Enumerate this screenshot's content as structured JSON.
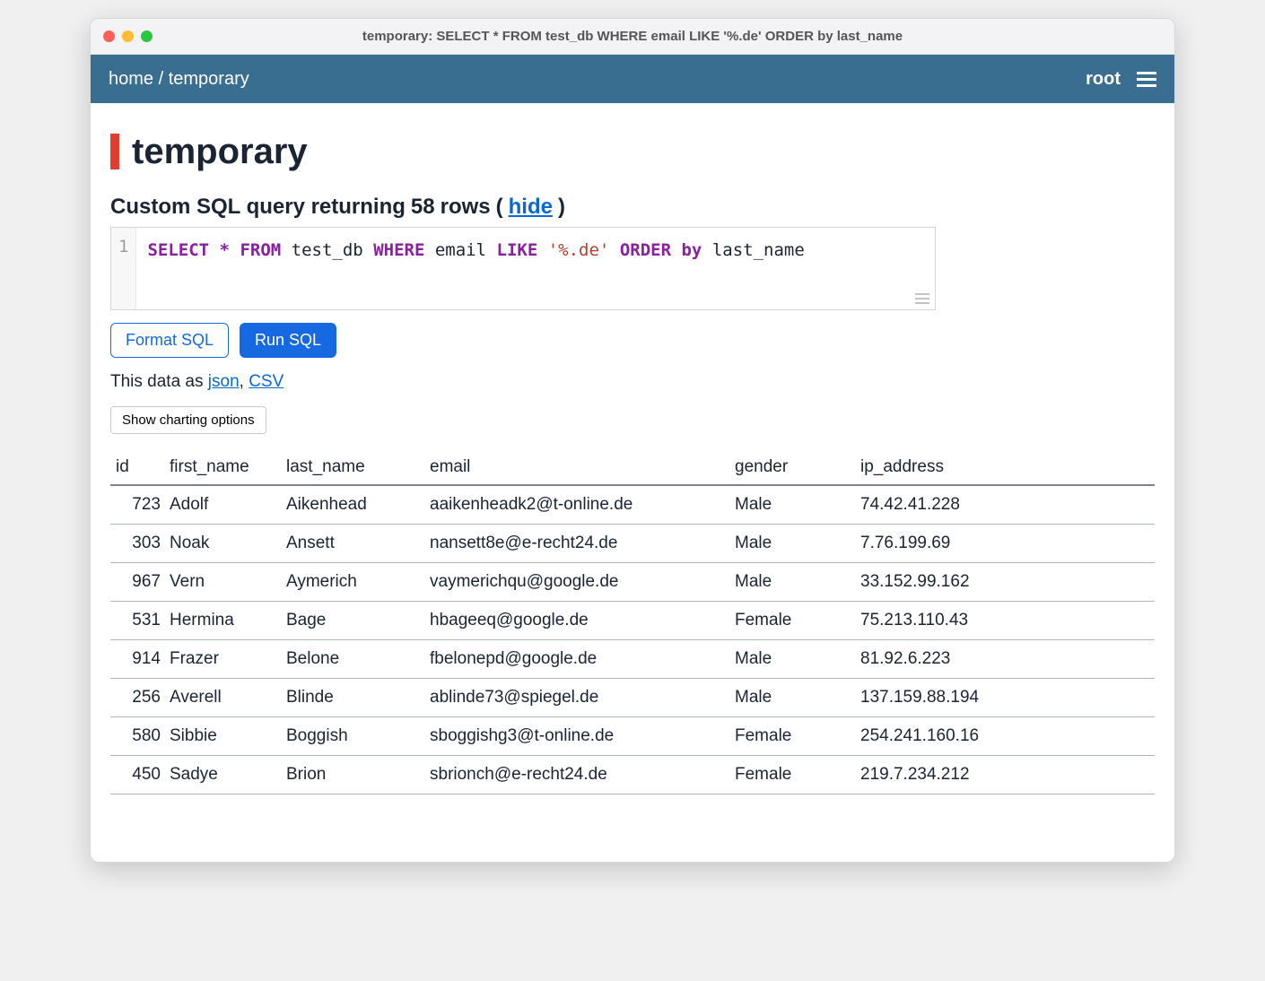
{
  "window": {
    "title": "temporary: SELECT * FROM test_db WHERE email LIKE '%.de' ORDER by last_name"
  },
  "breadcrumb": {
    "home": "home",
    "sep": "/",
    "current": "temporary"
  },
  "user": "root",
  "page_title": "temporary",
  "result_summary": {
    "prefix": "Custom SQL query returning",
    "row_count": "58",
    "rows_word": "rows",
    "lparen": "(",
    "hide": "hide",
    "rparen": ")"
  },
  "sql_tokens": [
    {
      "t": "SELECT",
      "c": "kw"
    },
    {
      "t": " ",
      "c": ""
    },
    {
      "t": "*",
      "c": "op"
    },
    {
      "t": " ",
      "c": ""
    },
    {
      "t": "FROM",
      "c": "kw"
    },
    {
      "t": " ",
      "c": ""
    },
    {
      "t": "test_db",
      "c": "ident"
    },
    {
      "t": " ",
      "c": ""
    },
    {
      "t": "WHERE",
      "c": "kw"
    },
    {
      "t": " ",
      "c": ""
    },
    {
      "t": "email",
      "c": "ident"
    },
    {
      "t": " ",
      "c": ""
    },
    {
      "t": "LIKE",
      "c": "kw"
    },
    {
      "t": " ",
      "c": ""
    },
    {
      "t": "'%.de'",
      "c": "str"
    },
    {
      "t": " ",
      "c": ""
    },
    {
      "t": "ORDER",
      "c": "kw"
    },
    {
      "t": " ",
      "c": ""
    },
    {
      "t": "by",
      "c": "kw"
    },
    {
      "t": " ",
      "c": ""
    },
    {
      "t": "last_name",
      "c": "ident"
    }
  ],
  "gutter_line": "1",
  "buttons": {
    "format": "Format SQL",
    "run": "Run SQL",
    "chart": "Show charting options"
  },
  "data_as": {
    "prefix": "This data as ",
    "json": "json",
    "sep": ", ",
    "csv": "CSV"
  },
  "columns": [
    "id",
    "first_name",
    "last_name",
    "email",
    "gender",
    "ip_address"
  ],
  "rows": [
    {
      "id": "723",
      "first_name": "Adolf",
      "last_name": "Aikenhead",
      "email": "aaikenheadk2@t-online.de",
      "gender": "Male",
      "ip_address": "74.42.41.228"
    },
    {
      "id": "303",
      "first_name": "Noak",
      "last_name": "Ansett",
      "email": "nansett8e@e-recht24.de",
      "gender": "Male",
      "ip_address": "7.76.199.69"
    },
    {
      "id": "967",
      "first_name": "Vern",
      "last_name": "Aymerich",
      "email": "vaymerichqu@google.de",
      "gender": "Male",
      "ip_address": "33.152.99.162"
    },
    {
      "id": "531",
      "first_name": "Hermina",
      "last_name": "Bage",
      "email": "hbageeq@google.de",
      "gender": "Female",
      "ip_address": "75.213.110.43"
    },
    {
      "id": "914",
      "first_name": "Frazer",
      "last_name": "Belone",
      "email": "fbelonepd@google.de",
      "gender": "Male",
      "ip_address": "81.92.6.223"
    },
    {
      "id": "256",
      "first_name": "Averell",
      "last_name": "Blinde",
      "email": "ablinde73@spiegel.de",
      "gender": "Male",
      "ip_address": "137.159.88.194"
    },
    {
      "id": "580",
      "first_name": "Sibbie",
      "last_name": "Boggish",
      "email": "sboggishg3@t-online.de",
      "gender": "Female",
      "ip_address": "254.241.160.16"
    },
    {
      "id": "450",
      "first_name": "Sadye",
      "last_name": "Brion",
      "email": "sbrionch@e-recht24.de",
      "gender": "Female",
      "ip_address": "219.7.234.212"
    }
  ]
}
